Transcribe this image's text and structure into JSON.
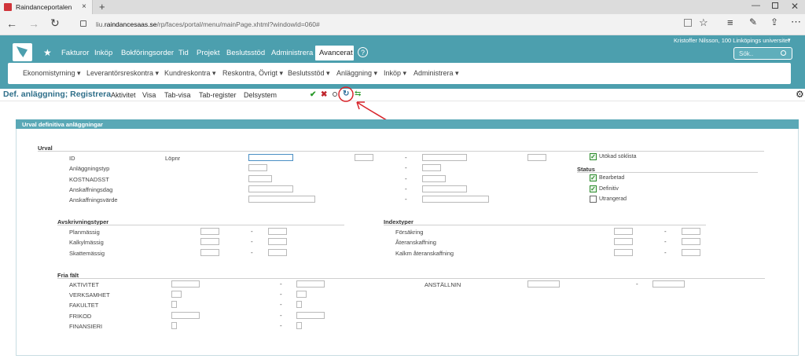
{
  "browser": {
    "tab_title": "Raindanceportalen",
    "url_prefix": "liu.",
    "url_host": "raindancesaas.se",
    "url_path": "/rp/faces/portal/menu/mainPage.xhtml?windowId=060#"
  },
  "header": {
    "user": "Kristoffer Nilsson, 100 Linköpings universitet",
    "search_placeholder": "Sök..",
    "nav": [
      "Fakturor",
      "Inköp",
      "Bokföringsorder",
      "Tid",
      "Projekt",
      "Beslutsstöd",
      "Administrera",
      "Avancerat"
    ],
    "active": "Avancerat"
  },
  "menu": [
    "Ekonomistyrning",
    "Leverantörsreskontra",
    "Kundreskontra",
    "Reskontra, Övrigt",
    "Beslutsstöd",
    "Anläggning",
    "Inköp",
    "Administrera"
  ],
  "subbar": {
    "title": "Def. anläggning; Registrera",
    "items": [
      "Aktivitet",
      "Visa",
      "Tab-visa",
      "Tab-register",
      "Delsystem"
    ]
  },
  "panel": {
    "title": "Urval definitiva anläggningar",
    "urval": {
      "heading": "Urval",
      "fields": [
        "ID",
        "Anläggningstyp",
        "KOSTNADSST",
        "Anskaffningsdag",
        "Anskaffningsvärde"
      ],
      "lopnr": "Löpnr"
    },
    "utokad": "Utökad söklista",
    "status": {
      "heading": "Status",
      "items": [
        {
          "label": "Bearbetad",
          "checked": true
        },
        {
          "label": "Definitiv",
          "checked": true
        },
        {
          "label": "Utrangerad",
          "checked": false
        }
      ]
    },
    "avskr": {
      "heading": "Avskrivningstyper",
      "items": [
        "Planmässig",
        "Kalkylmässig",
        "Skattemässig"
      ]
    },
    "index": {
      "heading": "Indextyper",
      "items": [
        "Försäkring",
        "Återanskaffning",
        "Kalkm återanskaffning"
      ]
    },
    "fria": {
      "heading": "Fria fält",
      "items": [
        "AKTIVITET",
        "VERKSAMHET",
        "FAKULTET",
        "FRIKOD",
        "FINANSIERI"
      ],
      "right": "ANSTÄLLNIN"
    }
  },
  "dash": "-"
}
